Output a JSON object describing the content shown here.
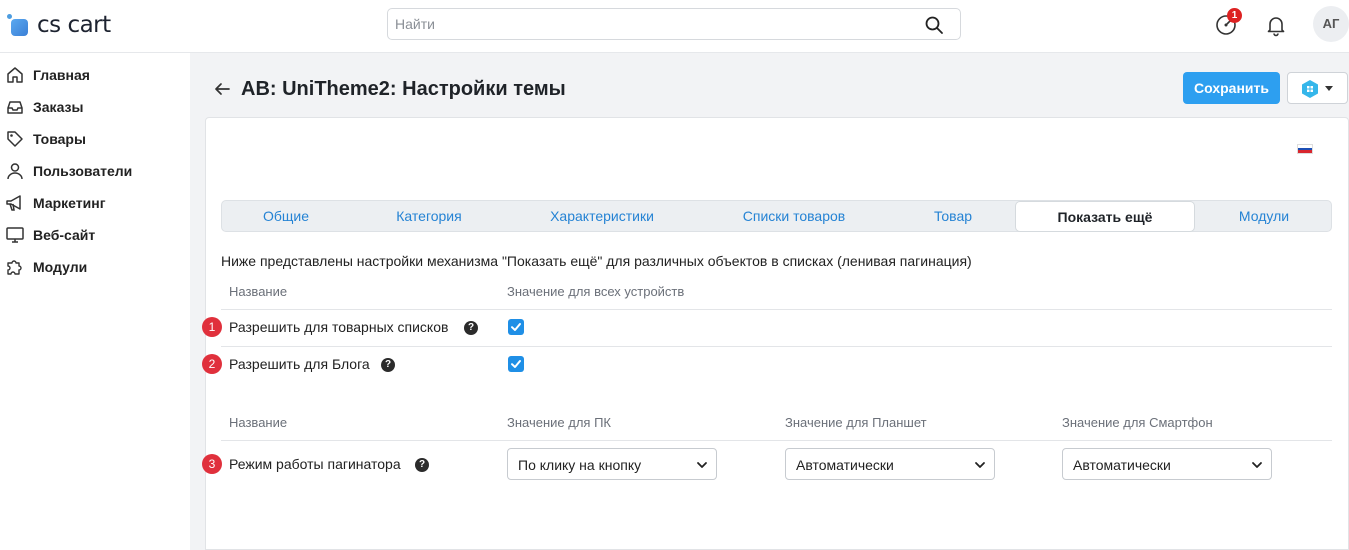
{
  "header": {
    "logo_text": "cs cart",
    "search_placeholder": "Найти",
    "notification_badge": "1",
    "avatar_initials": "АГ"
  },
  "sidebar": {
    "items": [
      {
        "label": "Главная",
        "icon": "home-icon"
      },
      {
        "label": "Заказы",
        "icon": "inbox-icon"
      },
      {
        "label": "Товары",
        "icon": "tag-icon"
      },
      {
        "label": "Пользователи",
        "icon": "user-icon"
      },
      {
        "label": "Маркетинг",
        "icon": "megaphone-icon"
      },
      {
        "label": "Веб-сайт",
        "icon": "monitor-icon"
      },
      {
        "label": "Модули",
        "icon": "puzzle-icon"
      }
    ]
  },
  "page": {
    "title": "AB: UniTheme2: Настройки темы",
    "save_label": "Сохранить"
  },
  "tabs": [
    {
      "label": "Общие",
      "active": false
    },
    {
      "label": "Категория",
      "active": false
    },
    {
      "label": "Характеристики",
      "active": false
    },
    {
      "label": "Списки товаров",
      "active": false
    },
    {
      "label": "Товар",
      "active": false
    },
    {
      "label": "Показать ещё",
      "active": true
    },
    {
      "label": "Модули",
      "active": false
    }
  ],
  "settings": {
    "description": "Ниже представлены настройки механизма \"Показать ещё\" для различных объектов в списках (ленивая пагинация)",
    "section1": {
      "col_name": "Название",
      "col_value": "Значение для всех устройств",
      "rows": [
        {
          "num": "1",
          "label": "Разрешить для товарных списков",
          "help": "?",
          "checked": true
        },
        {
          "num": "2",
          "label": "Разрешить для Блога",
          "help": "?",
          "checked": true
        }
      ]
    },
    "section2": {
      "col_name": "Название",
      "col_pc": "Значение для ПК",
      "col_tablet": "Значение для Планшет",
      "col_phone": "Значение для Смартфон",
      "rows": [
        {
          "num": "3",
          "label": "Режим работы пагинатора",
          "help": "?",
          "pc": "По клику на кнопку",
          "tablet": "Автоматически",
          "phone": "Автоматически"
        }
      ]
    }
  },
  "colors": {
    "accent": "#2d9ff0",
    "badge": "#e0303c",
    "link": "#2583d4"
  }
}
